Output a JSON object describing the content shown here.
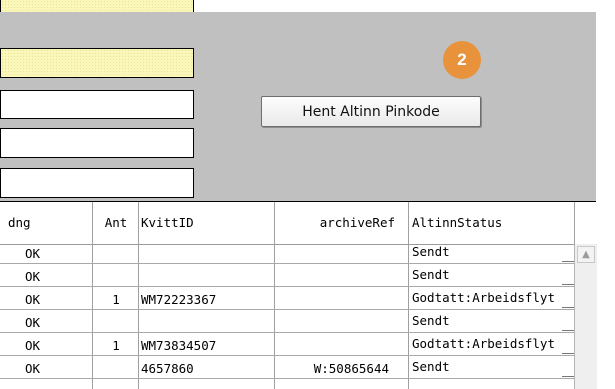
{
  "top": {
    "fetch_button_label": "Hent Altinn Pinkode",
    "badge_number": "2"
  },
  "table": {
    "headers": {
      "dng": "dng",
      "ant": "Ant",
      "kvittid": "KvittID",
      "archiveref": "archiveRef",
      "altinnstatus": "AltinnStatus"
    },
    "rows": [
      {
        "status_ok": "OK",
        "ant": "",
        "kvittid": "",
        "archiveref": "",
        "altinnstatus": "Sendt"
      },
      {
        "status_ok": "OK",
        "ant": "",
        "kvittid": "",
        "archiveref": "",
        "altinnstatus": "Sendt"
      },
      {
        "status_ok": "OK",
        "ant": "1",
        "kvittid": "WM72223367",
        "archiveref": "",
        "altinnstatus": "Godtatt:Arbeidsflyt"
      },
      {
        "status_ok": "OK",
        "ant": "",
        "kvittid": "",
        "archiveref": "",
        "altinnstatus": "Sendt"
      },
      {
        "status_ok": "OK",
        "ant": "1",
        "kvittid": "WM73834507",
        "archiveref": "",
        "altinnstatus": "Godtatt:Arbeidsflyt"
      },
      {
        "status_ok": "OK",
        "ant": "",
        "kvittid": "4657860",
        "archiveref": "W:50865644",
        "altinnstatus": "Sendt"
      }
    ]
  },
  "colors": {
    "panel_gray": "#c0c0c0",
    "field_yellow": "#fbf7b8",
    "badge_orange": "#e8923c"
  },
  "icons": {
    "scroll_up": "scroll-up-arrow-icon"
  }
}
